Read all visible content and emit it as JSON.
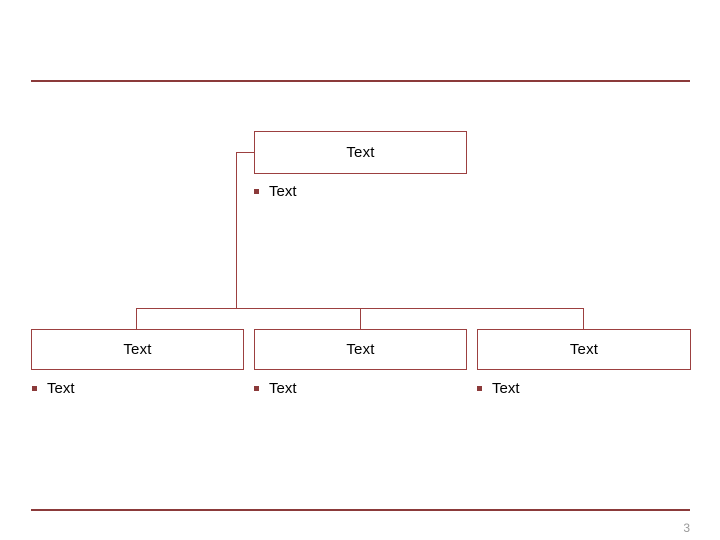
{
  "slide": {
    "page_number": "3",
    "accent_color": "#8B3A3A",
    "box_border_color": "#9C4040",
    "text_color": "#000000",
    "page_number_color": "#9A9A9A",
    "background_color": "#ffffff"
  },
  "diagram": {
    "type": "hierarchy",
    "top_node": {
      "label": "Text",
      "bullet": {
        "marker": "square-bullet-icon",
        "label": "Text"
      }
    },
    "child_nodes": [
      {
        "label": "Text",
        "bullet": {
          "marker": "square-bullet-icon",
          "label": "Text"
        }
      },
      {
        "label": "Text",
        "bullet": {
          "marker": "square-bullet-icon",
          "label": "Text"
        }
      },
      {
        "label": "Text",
        "bullet": {
          "marker": "square-bullet-icon",
          "label": "Text"
        }
      }
    ]
  }
}
